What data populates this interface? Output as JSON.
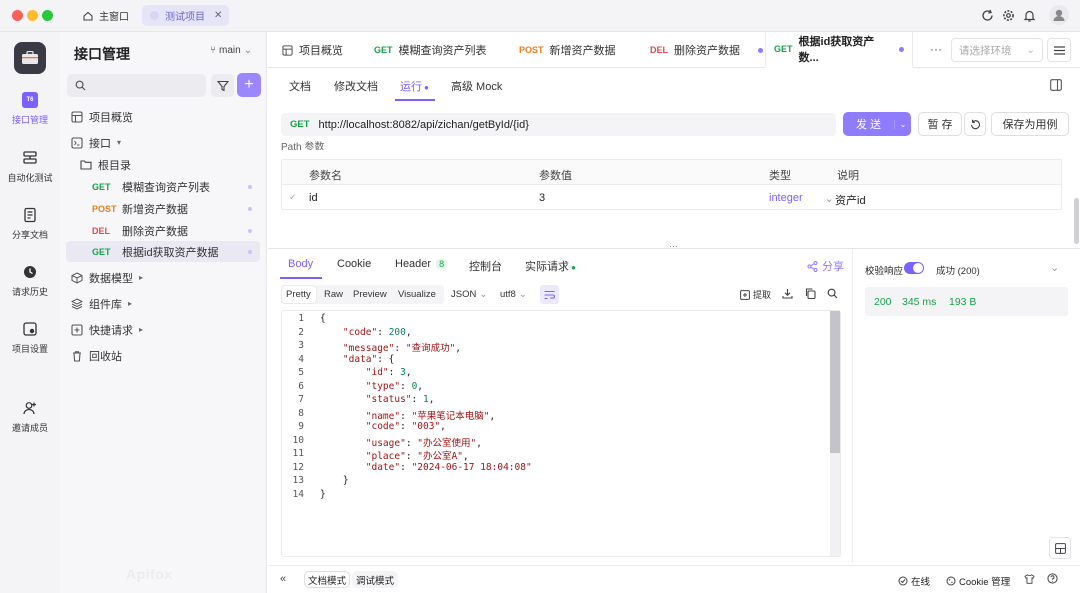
{
  "titlebar": {
    "tabs": [
      {
        "label": "主窗口"
      },
      {
        "label": "测试项目"
      }
    ]
  },
  "rail": {
    "items": [
      {
        "label": "接口管理"
      },
      {
        "label": "自动化测试"
      },
      {
        "label": "分享文档"
      },
      {
        "label": "请求历史"
      },
      {
        "label": "项目设置"
      },
      {
        "label": "邀请成员"
      }
    ],
    "badge": "T6"
  },
  "sidebar": {
    "title": "接口管理",
    "branch": "main",
    "search_placeholder": "",
    "overview": "项目概览",
    "interfaces": "接口",
    "root_dir": "根目录",
    "apis": [
      {
        "method": "GET",
        "name": "模糊查询资产列表"
      },
      {
        "method": "POST",
        "name": "新增资产数据"
      },
      {
        "method": "DEL",
        "name": "删除资产数据"
      },
      {
        "method": "GET",
        "name": "根据id获取资产数据"
      }
    ],
    "data_models": "数据模型",
    "components": "组件库",
    "quick_requests": "快捷请求",
    "recycle_bin": "回收站",
    "watermark": "Apifox"
  },
  "tabs": {
    "items": [
      {
        "method": "",
        "label": "项目概览"
      },
      {
        "method": "GET",
        "label": "模糊查询资产列表"
      },
      {
        "method": "POST",
        "label": "新增资产数据"
      },
      {
        "method": "DEL",
        "label": "删除资产数据"
      },
      {
        "method": "GET",
        "label": "根据id获取资产数..."
      }
    ],
    "more": "···",
    "env_placeholder": "请选择环境"
  },
  "subtabs": [
    "文档",
    "修改文档",
    "运行",
    "高级 Mock"
  ],
  "request": {
    "method": "GET",
    "url": "http://localhost:8082/api/zichan/getById/{id}",
    "send": "发 送",
    "save": "暂 存",
    "save_case": "保存为用例"
  },
  "params": {
    "section_label": "Path 参数",
    "headers": [
      "参数名",
      "参数值",
      "类型",
      "说明"
    ],
    "rows": [
      {
        "name": "id",
        "value": "3",
        "type": "integer",
        "desc": "资产id"
      }
    ]
  },
  "response": {
    "tabs": [
      "Body",
      "Cookie",
      "Header",
      "控制台",
      "实际请求"
    ],
    "header_count": "8",
    "share": "分享",
    "views": [
      "Pretty",
      "Raw",
      "Preview",
      "Visualize"
    ],
    "format": "JSON",
    "encoding": "utf8",
    "extract": "提取",
    "validate_label": "校验响应",
    "validate_result": "成功 (200)",
    "status": "200",
    "time": "345 ms",
    "size": "193 B",
    "code_lines": [
      "{",
      "    \"code\": 200,",
      "    \"message\": \"查询成功\",",
      "    \"data\": {",
      "        \"id\": 3,",
      "        \"type\": 0,",
      "        \"status\": 1,",
      "        \"name\": \"苹果笔记本电脑\",",
      "        \"code\": \"003\",",
      "        \"usage\": \"办公室使用\",",
      "        \"place\": \"办公室A\",",
      "        \"date\": \"2024-06-17 18:04:08\"",
      "    }",
      "}"
    ]
  },
  "statusbar": {
    "doc_mode": "文档模式",
    "debug_mode": "调试模式",
    "online": "在线",
    "cookie": "Cookie 管理"
  },
  "colors": {
    "accent": "#7b61ff",
    "get": "#17a34a",
    "post": "#f07b1a",
    "del": "#e5484d"
  }
}
